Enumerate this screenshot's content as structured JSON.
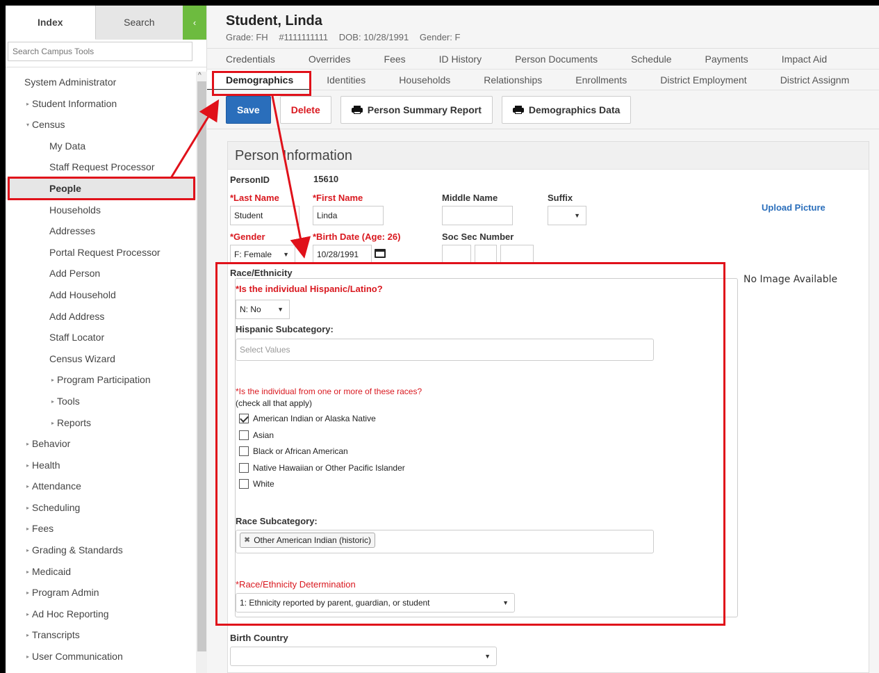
{
  "sidebar": {
    "tabs": {
      "index": "Index",
      "search": "Search",
      "collapse": "‹"
    },
    "search_placeholder": "Search Campus Tools",
    "items": [
      {
        "label": "System Administrator",
        "level": 0,
        "caret": ""
      },
      {
        "label": "Student Information",
        "level": 1,
        "caret": "▸"
      },
      {
        "label": "Census",
        "level": 1,
        "caret": "▾"
      },
      {
        "label": "My Data",
        "level": 2,
        "caret": ""
      },
      {
        "label": "Staff Request Processor",
        "level": 2,
        "caret": ""
      },
      {
        "label": "People",
        "level": 2,
        "caret": "",
        "active": true
      },
      {
        "label": "Households",
        "level": 2,
        "caret": ""
      },
      {
        "label": "Addresses",
        "level": 2,
        "caret": ""
      },
      {
        "label": "Portal Request Processor",
        "level": 2,
        "caret": ""
      },
      {
        "label": "Add Person",
        "level": 2,
        "caret": ""
      },
      {
        "label": "Add Household",
        "level": 2,
        "caret": ""
      },
      {
        "label": "Add Address",
        "level": 2,
        "caret": ""
      },
      {
        "label": "Staff Locator",
        "level": 2,
        "caret": ""
      },
      {
        "label": "Census Wizard",
        "level": 2,
        "caret": ""
      },
      {
        "label": "Program Participation",
        "level": 3,
        "caret": "▸"
      },
      {
        "label": "Tools",
        "level": 3,
        "caret": "▸"
      },
      {
        "label": "Reports",
        "level": 3,
        "caret": "▸"
      },
      {
        "label": "Behavior",
        "level": 1,
        "caret": "▸"
      },
      {
        "label": "Health",
        "level": 1,
        "caret": "▸"
      },
      {
        "label": "Attendance",
        "level": 1,
        "caret": "▸"
      },
      {
        "label": "Scheduling",
        "level": 1,
        "caret": "▸"
      },
      {
        "label": "Fees",
        "level": 1,
        "caret": "▸"
      },
      {
        "label": "Grading & Standards",
        "level": 1,
        "caret": "▸"
      },
      {
        "label": "Medicaid",
        "level": 1,
        "caret": "▸"
      },
      {
        "label": "Program Admin",
        "level": 1,
        "caret": "▸"
      },
      {
        "label": "Ad Hoc Reporting",
        "level": 1,
        "caret": "▸"
      },
      {
        "label": "Transcripts",
        "level": 1,
        "caret": "▸"
      },
      {
        "label": "User Communication",
        "level": 1,
        "caret": "▸"
      }
    ]
  },
  "header": {
    "name": "Student, Linda",
    "grade": "Grade: FH",
    "id": "#1111111111",
    "dob": "DOB: 10/28/1991",
    "gender": "Gender: F"
  },
  "tabs_row1": [
    "Credentials",
    "Overrides",
    "Fees",
    "ID History",
    "Person Documents",
    "Schedule",
    "Payments",
    "Impact Aid"
  ],
  "tabs_row2": [
    "Demographics",
    "Identities",
    "Households",
    "Relationships",
    "Enrollments",
    "District Employment",
    "District Assignm"
  ],
  "toolbar": {
    "save": "Save",
    "delete": "Delete",
    "summary_report": "Person Summary Report",
    "demographics_data": "Demographics Data"
  },
  "person": {
    "panel_title": "Person Information",
    "person_id_label": "PersonID",
    "person_id": "15610",
    "last_name_label": "*Last Name",
    "last_name": "Student",
    "first_name_label": "*First Name",
    "first_name": "Linda",
    "middle_name_label": "Middle Name",
    "middle_name": "",
    "suffix_label": "Suffix",
    "suffix": "",
    "gender_label": "*Gender",
    "gender": "F: Female",
    "birth_label": "*Birth Date (Age: 26)",
    "birth_date": "10/28/1991",
    "ssn_label": "Soc Sec Number",
    "upload_picture": "Upload Picture",
    "no_image": "No Image Available"
  },
  "race": {
    "section_label": "Race/Ethnicity",
    "hispanic_q": "*Is the individual Hispanic/Latino?",
    "hispanic_value": "N: No",
    "hispanic_sub_label": "Hispanic Subcategory:",
    "hispanic_sub_placeholder": "Select Values",
    "races_q": "*Is the individual from one or more of these races?",
    "races_hint": "(check all that apply)",
    "options": [
      {
        "label": "American Indian or Alaska Native",
        "checked": true
      },
      {
        "label": "Asian",
        "checked": false
      },
      {
        "label": "Black or African American",
        "checked": false
      },
      {
        "label": "Native Hawaiian or Other Pacific Islander",
        "checked": false
      },
      {
        "label": "White",
        "checked": false
      }
    ],
    "race_sub_label": "Race Subcategory:",
    "race_sub_chip": "Other American Indian (historic)",
    "determination_label": "*Race/Ethnicity Determination",
    "determination_value": "1: Ethnicity reported by parent, guardian, or student"
  },
  "birth_country_label": "Birth Country",
  "birth_country_value": "",
  "colors": {
    "accent_blue": "#2a6ebb",
    "required_red": "#d9181f",
    "annotation_red": "#e0111a",
    "collapse_green": "#6dbb3f"
  }
}
